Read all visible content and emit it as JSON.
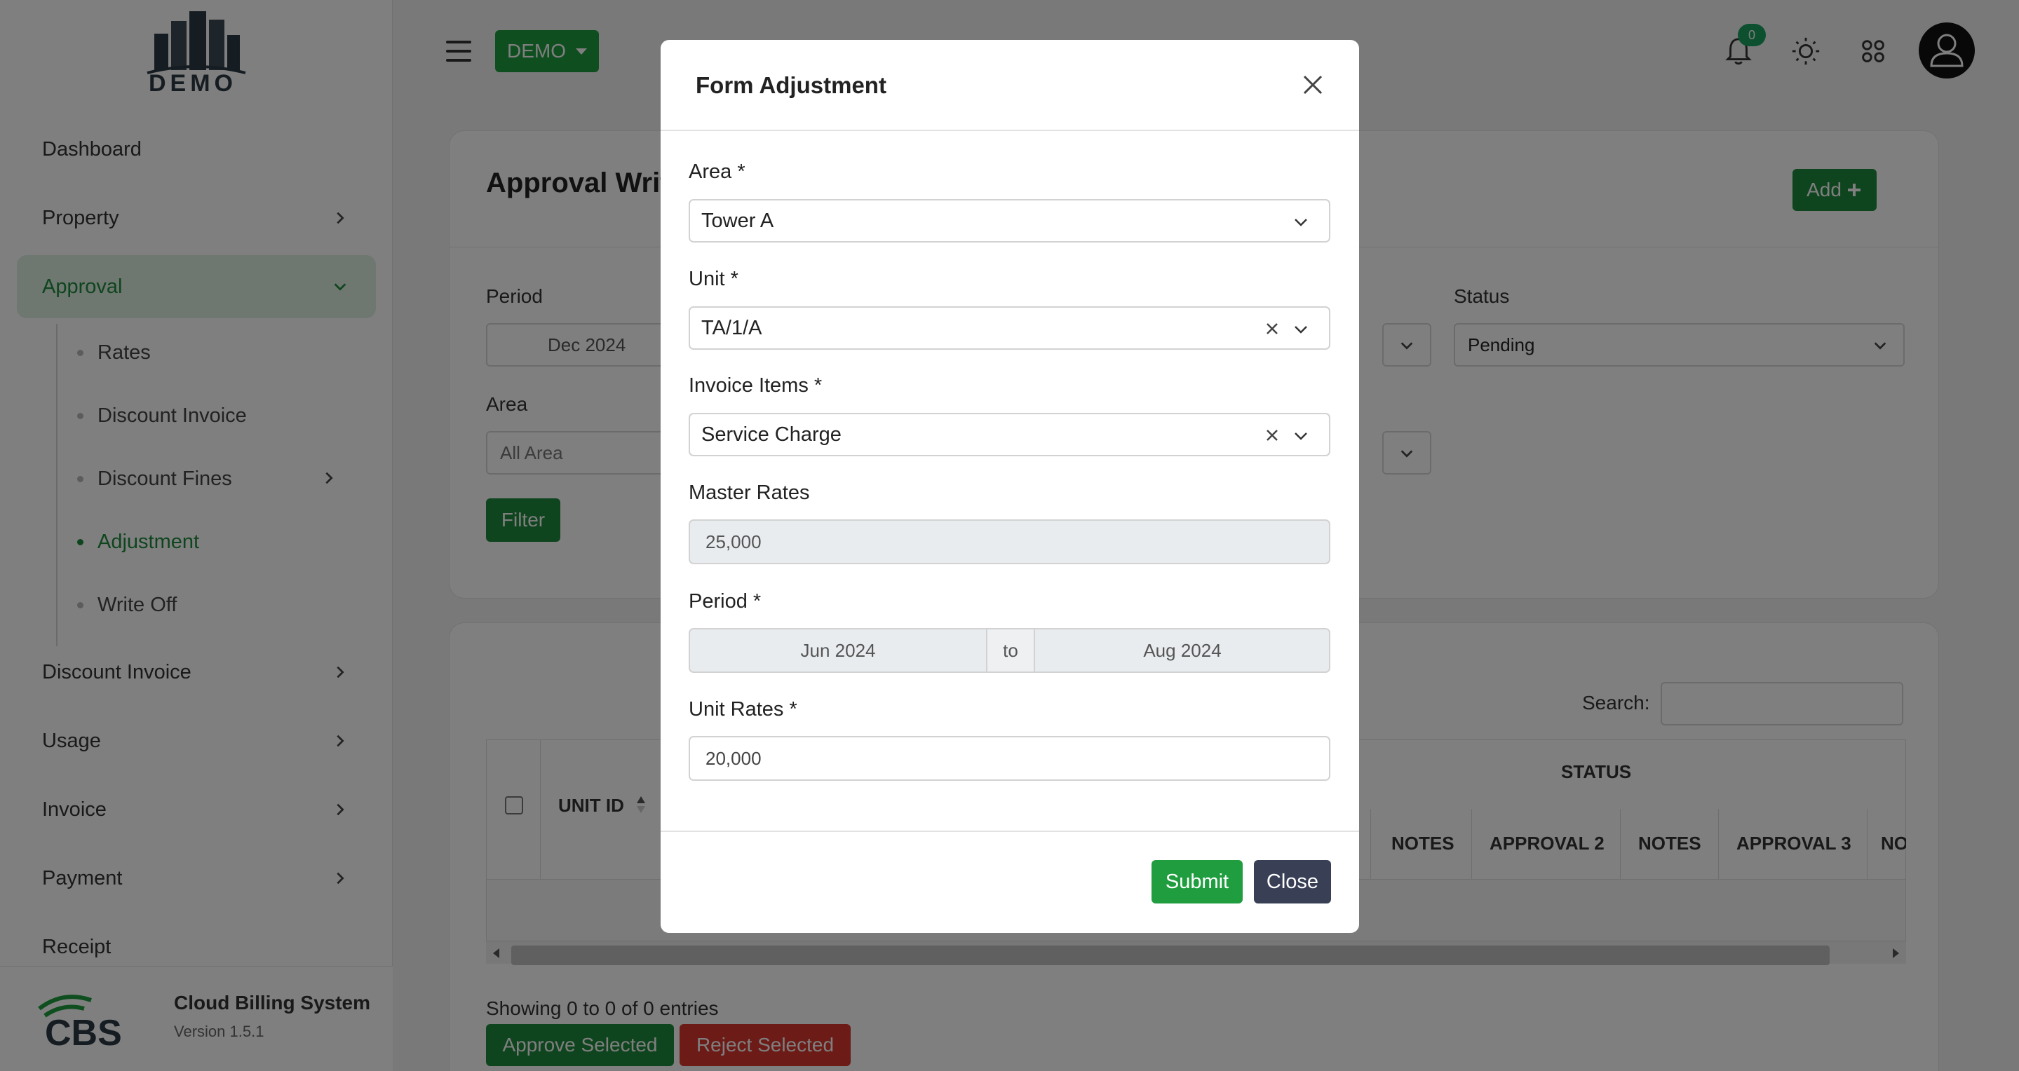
{
  "sidebar": {
    "logo_text": "DEMO",
    "items": [
      {
        "label": "Dashboard"
      },
      {
        "label": "Property"
      },
      {
        "label": "Approval"
      },
      {
        "label": "Discount Invoice"
      },
      {
        "label": "Usage"
      },
      {
        "label": "Invoice"
      },
      {
        "label": "Payment"
      },
      {
        "label": "Receipt"
      }
    ],
    "approval_sub": [
      {
        "label": "Rates"
      },
      {
        "label": "Discount Invoice"
      },
      {
        "label": "Discount Fines"
      },
      {
        "label": "Adjustment"
      },
      {
        "label": "Write Off"
      }
    ],
    "footer": {
      "app_name": "Cloud Billing System",
      "version": "Version 1.5.1",
      "logo_text": "CBS"
    }
  },
  "topbar": {
    "demo_label": "DEMO",
    "notification_count": "0",
    "icons": [
      "menu-icon",
      "bell-icon",
      "sun-icon",
      "apps-grid-icon",
      "user-icon"
    ]
  },
  "filters": {
    "title": "Approval Writ",
    "add_label": "Add",
    "period_label": "Period",
    "period_value": "Dec 2024",
    "status_label": "Status",
    "status_value": "Pending",
    "area_label": "Area",
    "area_placeholder": "All Area",
    "filter_label": "Filter"
  },
  "table": {
    "search_label": "Search:",
    "headers": {
      "unit_id": "UNIT ID",
      "status": "STATUS",
      "notes1": "NOTES",
      "approval2": "APPROVAL 2",
      "notes2": "NOTES",
      "approval3": "APPROVAL 3",
      "notes3": "NO"
    },
    "entries": "Showing 0 to 0 of 0 entries",
    "approve_label": "Approve Selected",
    "reject_label": "Reject Selected"
  },
  "modal": {
    "title": "Form Adjustment",
    "area_label": "Area *",
    "area_value": "Tower A",
    "unit_label": "Unit *",
    "unit_value": "TA/1/A",
    "items_label": "Invoice Items *",
    "items_value": "Service Charge",
    "master_label": "Master Rates",
    "master_value": "25,000",
    "period_label": "Period *",
    "period_from": "Jun 2024",
    "period_to_word": "to",
    "period_until": "Aug 2024",
    "unit_rates_label": "Unit Rates *",
    "unit_rates_value": "20,000",
    "submit_label": "Submit",
    "close_label": "Close"
  },
  "colors": {
    "primary": "#1f8a3c",
    "danger": "#d9372f",
    "dark": "#394056"
  }
}
